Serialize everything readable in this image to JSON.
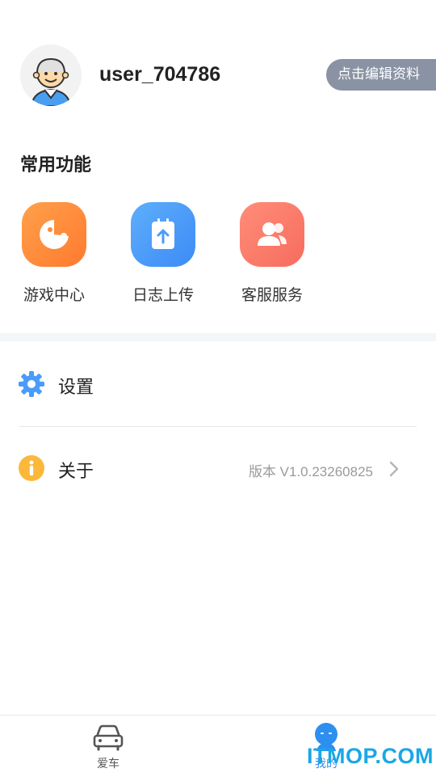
{
  "profile": {
    "username": "user_704786",
    "edit_label": "点击编辑资料"
  },
  "features": {
    "title": "常用功能",
    "items": [
      {
        "label": "游戏中心",
        "icon": "game-controller-icon",
        "color": "#ff8a3d"
      },
      {
        "label": "日志上传",
        "icon": "log-upload-icon",
        "color": "#4b9bfa"
      },
      {
        "label": "客服服务",
        "icon": "customer-service-icon",
        "color": "#fb7b6b"
      }
    ]
  },
  "menu": {
    "settings": {
      "label": "设置",
      "icon": "gear-icon",
      "color": "#4b9bfa"
    },
    "about": {
      "label": "关于",
      "value": "版本 V1.0.23260825",
      "icon": "info-icon",
      "color": "#fbb83a"
    }
  },
  "tabbar": {
    "tabs": [
      {
        "label": "爱车",
        "icon": "car-icon",
        "active": false
      },
      {
        "label": "我的",
        "icon": "profile-icon",
        "active": true
      }
    ],
    "active_color": "#2d8ff0"
  },
  "watermark": "ITMOP.COM"
}
